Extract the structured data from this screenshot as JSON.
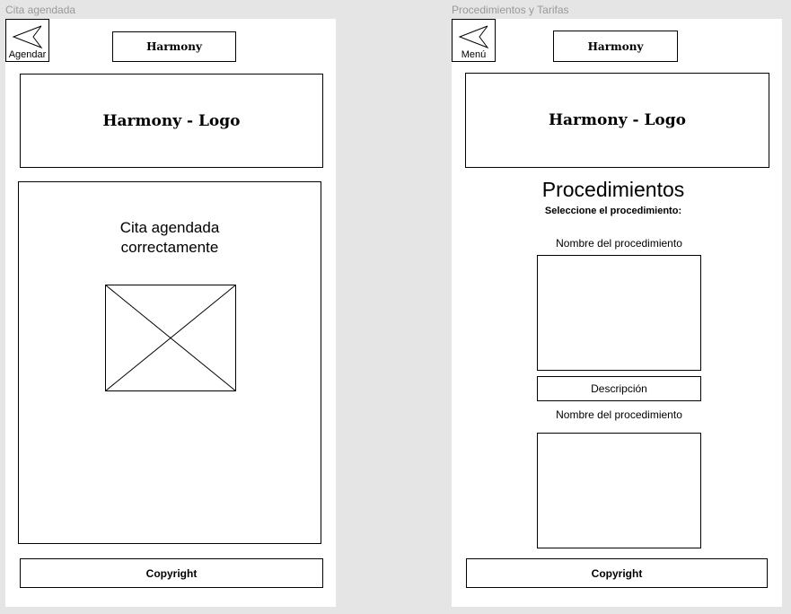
{
  "left_frame": {
    "label": "Cita agendada",
    "back_label": "Agendar",
    "brand": "Harmony",
    "logo": "Harmony - Logo",
    "confirmation_line1": "Cita agendada",
    "confirmation_line2": "correctamente",
    "image_icon": "image-placeholder-icon",
    "footer": "Copyright"
  },
  "right_frame": {
    "label": "Procedimientos y Tarifas",
    "back_label": "Menú",
    "brand": "Harmony",
    "logo": "Harmony - Logo",
    "title": "Procedimientos",
    "subtitle": "Seleccione el procedimiento:",
    "procedures": [
      {
        "name": "Nombre del procedimiento",
        "button": "Descripción"
      },
      {
        "name": "Nombre del procedimiento"
      }
    ],
    "footer": "Copyright"
  }
}
